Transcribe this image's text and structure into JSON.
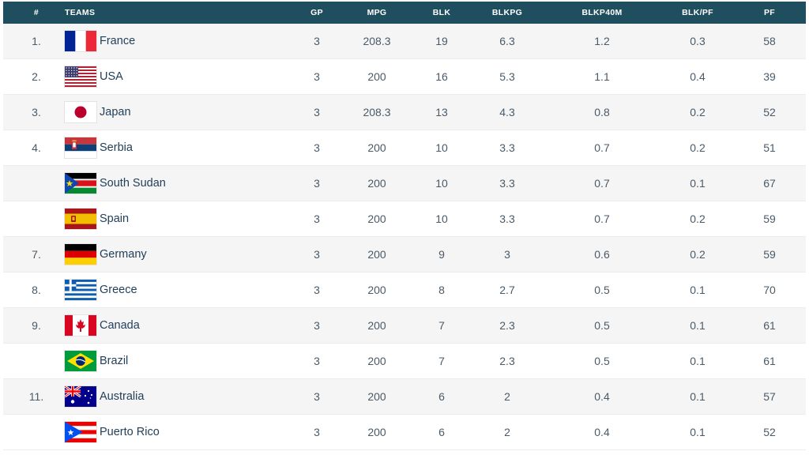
{
  "columns": {
    "rank": "#",
    "team": "TEAMS",
    "gp": "GP",
    "mpg": "MPG",
    "blk": "BLK",
    "blkpg": "BLKPG",
    "blkp40m": "BLKP40M",
    "blkpf": "BLK/PF",
    "pf": "PF"
  },
  "rows": [
    {
      "rank": "1.",
      "team": "France",
      "flag": "france-flag",
      "gp": "3",
      "mpg": "208.3",
      "blk": "19",
      "blkpg": "6.3",
      "blkp40m": "1.2",
      "blkpf": "0.3",
      "pf": "58"
    },
    {
      "rank": "2.",
      "team": "USA",
      "flag": "usa-flag",
      "gp": "3",
      "mpg": "200",
      "blk": "16",
      "blkpg": "5.3",
      "blkp40m": "1.1",
      "blkpf": "0.4",
      "pf": "39"
    },
    {
      "rank": "3.",
      "team": "Japan",
      "flag": "japan-flag",
      "gp": "3",
      "mpg": "208.3",
      "blk": "13",
      "blkpg": "4.3",
      "blkp40m": "0.8",
      "blkpf": "0.2",
      "pf": "52"
    },
    {
      "rank": "4.",
      "team": "Serbia",
      "flag": "serbia-flag",
      "gp": "3",
      "mpg": "200",
      "blk": "10",
      "blkpg": "3.3",
      "blkp40m": "0.7",
      "blkpf": "0.2",
      "pf": "51"
    },
    {
      "rank": "",
      "team": "South Sudan",
      "flag": "south-sudan-flag",
      "gp": "3",
      "mpg": "200",
      "blk": "10",
      "blkpg": "3.3",
      "blkp40m": "0.7",
      "blkpf": "0.1",
      "pf": "67"
    },
    {
      "rank": "",
      "team": "Spain",
      "flag": "spain-flag",
      "gp": "3",
      "mpg": "200",
      "blk": "10",
      "blkpg": "3.3",
      "blkp40m": "0.7",
      "blkpf": "0.2",
      "pf": "59"
    },
    {
      "rank": "7.",
      "team": "Germany",
      "flag": "germany-flag",
      "gp": "3",
      "mpg": "200",
      "blk": "9",
      "blkpg": "3",
      "blkp40m": "0.6",
      "blkpf": "0.2",
      "pf": "59"
    },
    {
      "rank": "8.",
      "team": "Greece",
      "flag": "greece-flag",
      "gp": "3",
      "mpg": "200",
      "blk": "8",
      "blkpg": "2.7",
      "blkp40m": "0.5",
      "blkpf": "0.1",
      "pf": "70"
    },
    {
      "rank": "9.",
      "team": "Canada",
      "flag": "canada-flag",
      "gp": "3",
      "mpg": "200",
      "blk": "7",
      "blkpg": "2.3",
      "blkp40m": "0.5",
      "blkpf": "0.1",
      "pf": "61"
    },
    {
      "rank": "",
      "team": "Brazil",
      "flag": "brazil-flag",
      "gp": "3",
      "mpg": "200",
      "blk": "7",
      "blkpg": "2.3",
      "blkp40m": "0.5",
      "blkpf": "0.1",
      "pf": "61"
    },
    {
      "rank": "11.",
      "team": "Australia",
      "flag": "australia-flag",
      "gp": "3",
      "mpg": "200",
      "blk": "6",
      "blkpg": "2",
      "blkp40m": "0.4",
      "blkpf": "0.1",
      "pf": "57"
    },
    {
      "rank": "",
      "team": "Puerto Rico",
      "flag": "puerto-rico-flag",
      "gp": "3",
      "mpg": "200",
      "blk": "6",
      "blkpg": "2",
      "blkp40m": "0.4",
      "blkpf": "0.1",
      "pf": "52"
    }
  ],
  "colors": {
    "header_bg": "#1f4e5f",
    "row_alt_bg": "#f5f5f5",
    "text": "#4a5a68",
    "team_text": "#23405a"
  }
}
